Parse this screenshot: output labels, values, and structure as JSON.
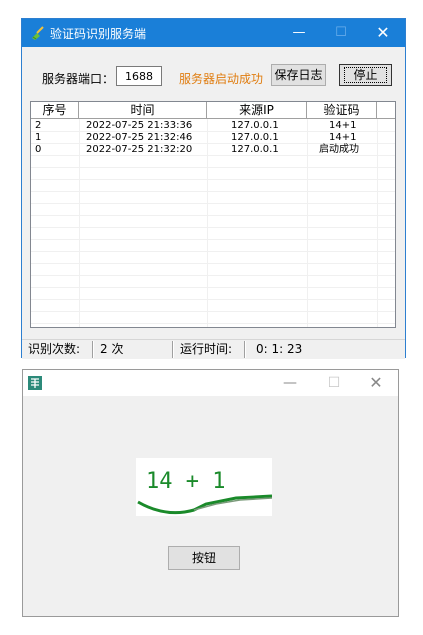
{
  "main_window": {
    "title": "验证码识别服务端",
    "minimize_glyph": "—",
    "maximize_glyph": "☐",
    "close_glyph": "✕",
    "port_label": "服务器端口：",
    "port_value": "1688",
    "server_status": "服务器启动成功",
    "save_log_label": "保存日志",
    "stop_label": "停止",
    "columns": [
      "序号",
      "时间",
      "来源IP",
      "验证码"
    ],
    "rows": [
      {
        "seq": "2",
        "time": "2022-07-25 21:33:36",
        "ip": "127.0.0.1",
        "code": "14+1"
      },
      {
        "seq": "1",
        "time": "2022-07-25 21:32:46",
        "ip": "127.0.0.1",
        "code": "14+1"
      },
      {
        "seq": "0",
        "time": "2022-07-25 21:32:20",
        "ip": "127.0.0.1",
        "code": "启动成功"
      }
    ],
    "statusbar": {
      "count_label": "识别次数:",
      "count_value": "2 次",
      "runtime_label": "运行时间:",
      "runtime_value": "0: 1: 23"
    }
  },
  "client_window": {
    "minimize_glyph": "—",
    "maximize_glyph": "☐",
    "close_glyph": "✕",
    "captcha_text": "14 + 1",
    "button_label": "按钮"
  },
  "colors": {
    "titlebar_blue": "#1a7fd8",
    "status_orange": "#e07d10",
    "captcha_green": "#1a8a2a"
  }
}
